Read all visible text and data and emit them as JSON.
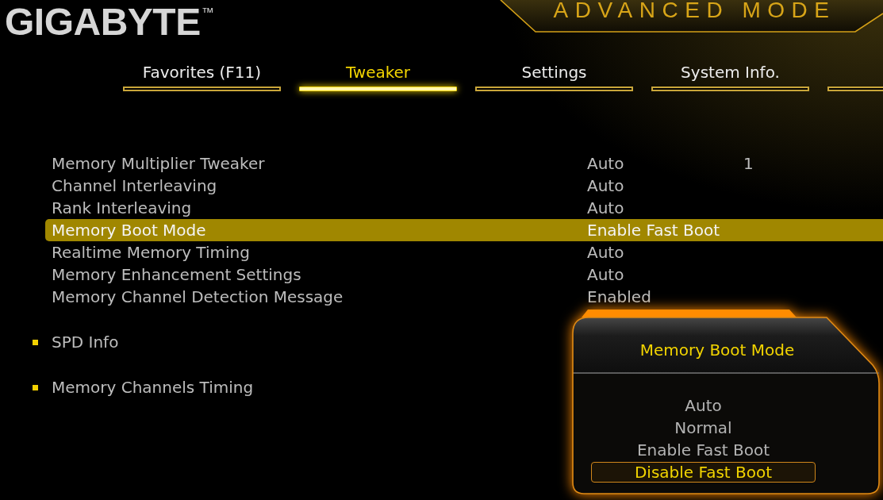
{
  "header": {
    "logo": "GIGABYTE",
    "trademark": "™",
    "mode_title": "ADVANCED MODE"
  },
  "tabs": [
    {
      "label": "Favorites (F11)",
      "selected": false
    },
    {
      "label": "Tweaker",
      "selected": true
    },
    {
      "label": "Settings",
      "selected": false
    },
    {
      "label": "System Info.",
      "selected": false
    }
  ],
  "settings": [
    {
      "label": "Memory Multiplier Tweaker",
      "value": "Auto",
      "column_3": "1",
      "selected": false
    },
    {
      "label": "Channel Interleaving",
      "value": "Auto",
      "selected": false
    },
    {
      "label": "Rank Interleaving",
      "value": "Auto",
      "selected": false
    },
    {
      "label": "Memory Boot Mode",
      "value": "Enable Fast Boot",
      "selected": true
    },
    {
      "label": "Realtime Memory Timing",
      "value": "Auto",
      "selected": false
    },
    {
      "label": "Memory Enhancement Settings",
      "value": "Auto",
      "selected": false
    },
    {
      "label": "Memory Channel Detection Message",
      "value": "Enabled",
      "selected": false
    }
  ],
  "submenus": [
    {
      "label": "SPD Info"
    },
    {
      "label": "Memory Channels Timing"
    }
  ],
  "popup": {
    "title": "Memory Boot Mode",
    "options": [
      {
        "label": "Auto",
        "selected": false
      },
      {
        "label": "Normal",
        "selected": false
      },
      {
        "label": "Enable Fast Boot",
        "selected": false
      },
      {
        "label": "Disable Fast Boot",
        "selected": true
      }
    ]
  }
}
